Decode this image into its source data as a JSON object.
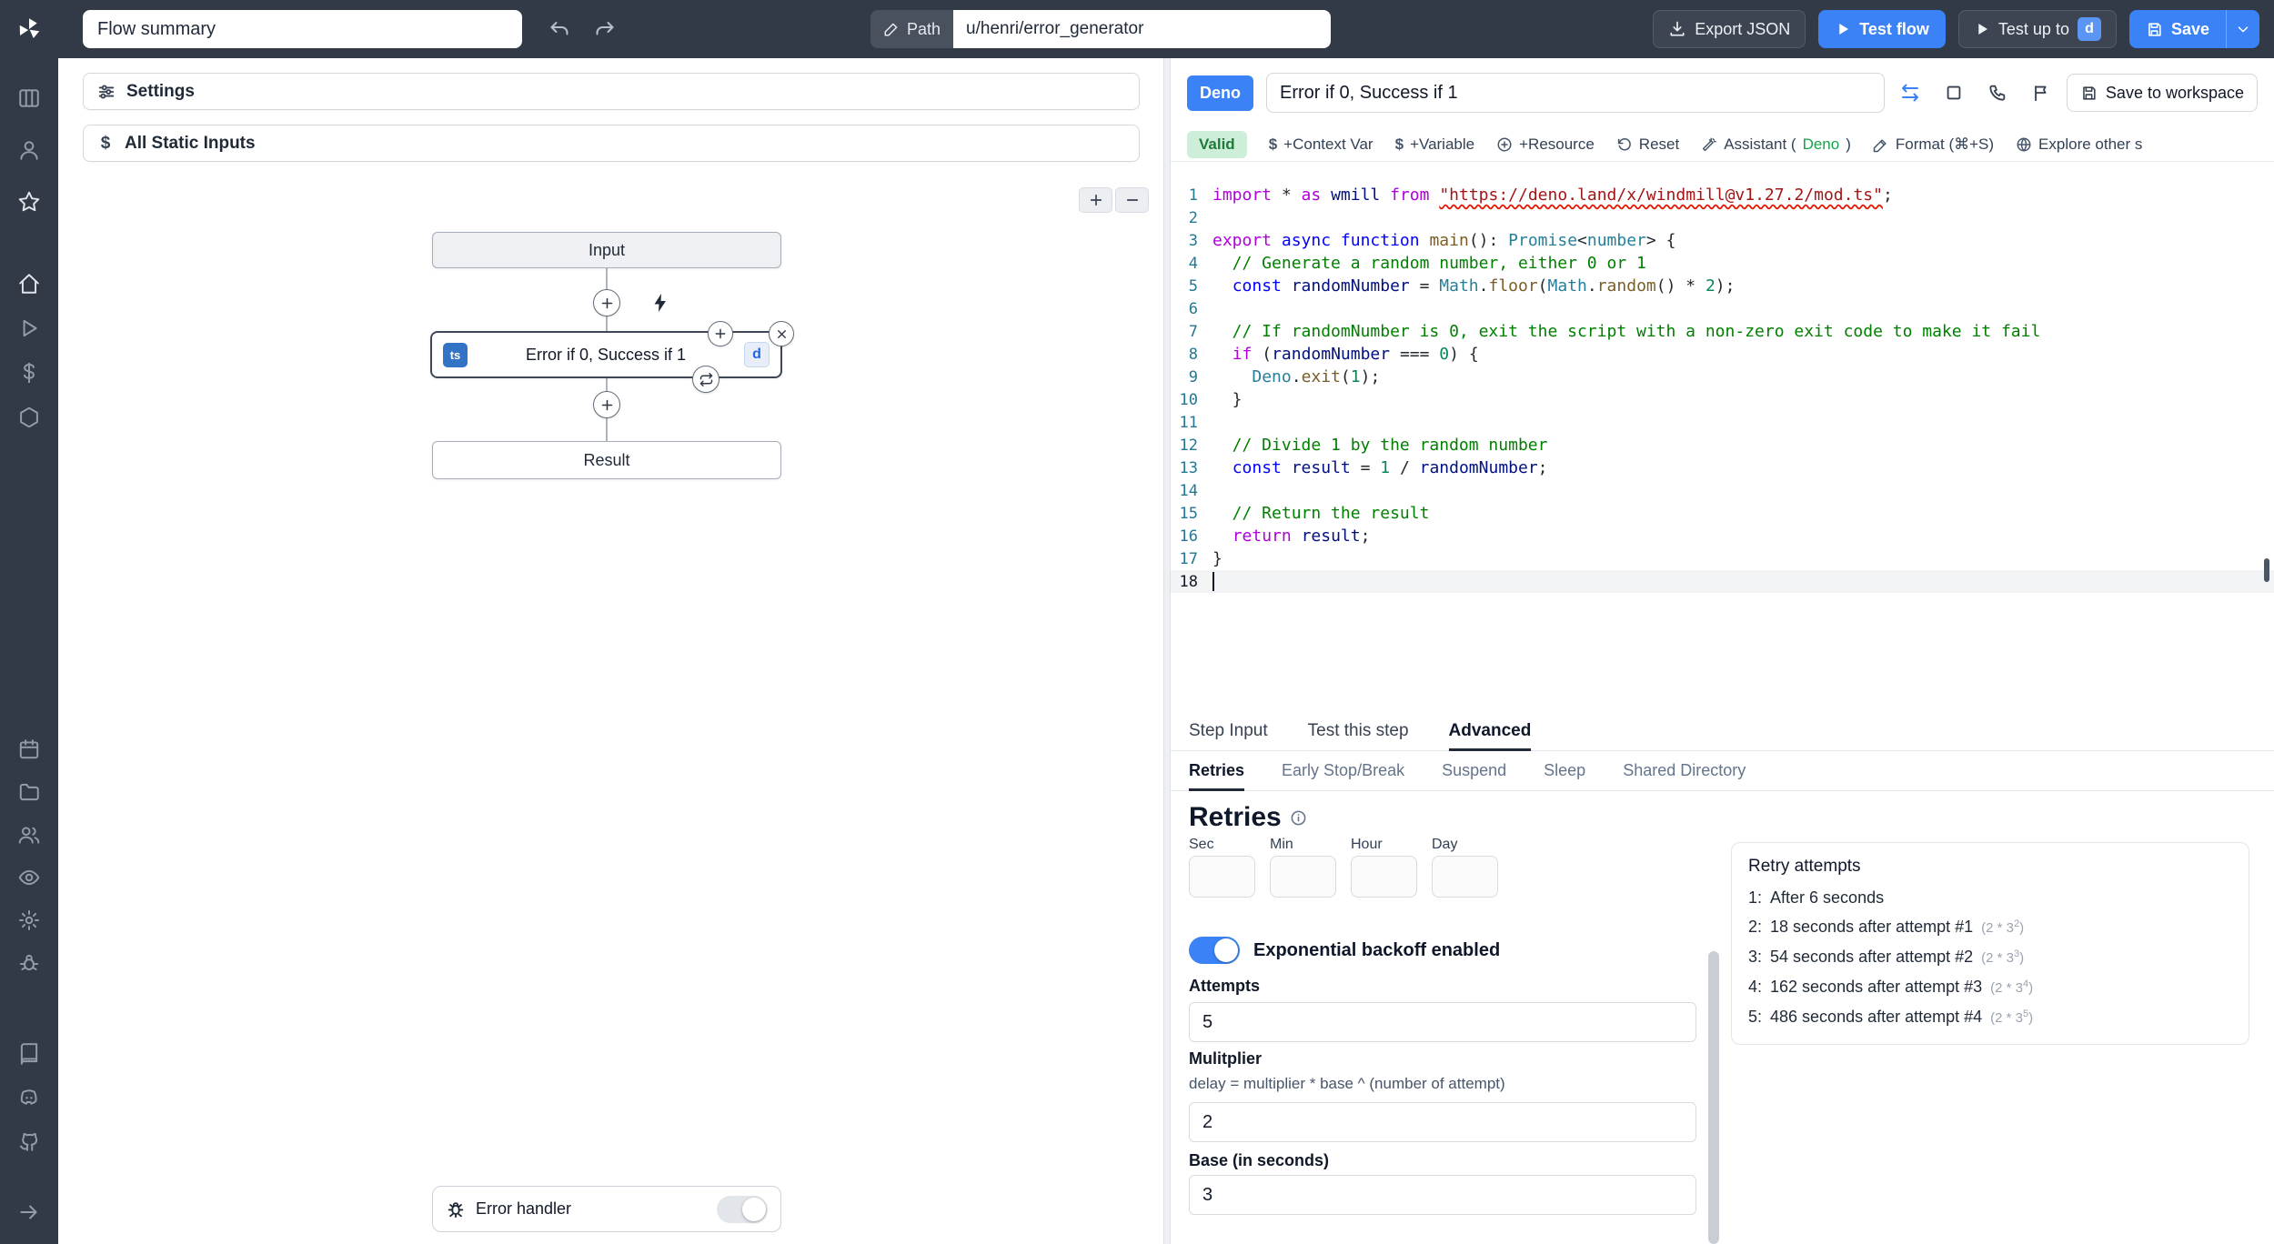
{
  "colors": {
    "accent": "#3b82f6",
    "chrome": "#333a47",
    "valid_bg": "#cdeed9",
    "valid_text": "#217a3c",
    "deno_green": "#16a34a"
  },
  "topbar": {
    "flow_summary": "Flow summary",
    "path_label": "Path",
    "path_value": "u/henri/error_generator",
    "export_json": "Export JSON",
    "test_flow": "Test flow",
    "test_up_to": "Test up to",
    "test_up_to_badge": "d",
    "save": "Save"
  },
  "sidebar": {
    "groups": [
      [
        "columns",
        "user",
        "star"
      ],
      [
        "home",
        "play",
        "dollar",
        "modules"
      ],
      [
        "calendar",
        "folder",
        "users",
        "eye",
        "gear",
        "worker"
      ],
      [
        "book",
        "discord",
        "github"
      ]
    ],
    "expand_icon": "expand"
  },
  "flow": {
    "settings_label": "Settings",
    "static_inputs_label": "All Static Inputs",
    "nodes": {
      "input": "Input",
      "step_lang": "ts",
      "step_title": "Error if 0, Success if 1",
      "step_badge": "d",
      "result": "Result"
    },
    "error_handler_label": "Error handler"
  },
  "editor": {
    "lang_badge": "Deno",
    "step_name": "Error if 0, Success if 1",
    "save_to_workspace": "Save to workspace",
    "valid": "Valid",
    "toolbar": {
      "context_var": "+Context Var",
      "variable": "+Variable",
      "resource": "+Resource",
      "reset": "Reset",
      "assistant_prefix": "Assistant (",
      "assistant_lang": "Deno",
      "assistant_suffix": ")",
      "format": "Format (⌘+S)",
      "explore": "Explore other s"
    }
  },
  "code": {
    "current_line": 18,
    "lines": [
      [
        {
          "t": "import",
          "c": "ct"
        },
        {
          "t": " * ",
          "c": "pn"
        },
        {
          "t": "as",
          "c": "ct"
        },
        {
          "t": " ",
          "c": "pn"
        },
        {
          "t": "wmill",
          "c": "vr"
        },
        {
          "t": " ",
          "c": "pn"
        },
        {
          "t": "from",
          "c": "ct"
        },
        {
          "t": " ",
          "c": "pn"
        },
        {
          "t": "\"https://deno.land/x/windmill@v1.27.2/mod.ts\"",
          "c": "st sq"
        },
        {
          "t": ";",
          "c": "pn"
        }
      ],
      [],
      [
        {
          "t": "export",
          "c": "ct"
        },
        {
          "t": " ",
          "c": "pn"
        },
        {
          "t": "async",
          "c": "kw"
        },
        {
          "t": " ",
          "c": "pn"
        },
        {
          "t": "function",
          "c": "kw"
        },
        {
          "t": " ",
          "c": "pn"
        },
        {
          "t": "main",
          "c": "fn"
        },
        {
          "t": "(): ",
          "c": "pn"
        },
        {
          "t": "Promise",
          "c": "ty"
        },
        {
          "t": "<",
          "c": "pn"
        },
        {
          "t": "number",
          "c": "ty"
        },
        {
          "t": "> {",
          "c": "pn"
        }
      ],
      [
        {
          "t": "  // Generate a random number, either 0 or 1",
          "c": "cm"
        }
      ],
      [
        {
          "t": "  ",
          "c": "pn"
        },
        {
          "t": "const",
          "c": "kw"
        },
        {
          "t": " ",
          "c": "pn"
        },
        {
          "t": "randomNumber",
          "c": "vr"
        },
        {
          "t": " = ",
          "c": "pn"
        },
        {
          "t": "Math",
          "c": "ty"
        },
        {
          "t": ".",
          "c": "pn"
        },
        {
          "t": "floor",
          "c": "fn"
        },
        {
          "t": "(",
          "c": "pn"
        },
        {
          "t": "Math",
          "c": "ty"
        },
        {
          "t": ".",
          "c": "pn"
        },
        {
          "t": "random",
          "c": "fn"
        },
        {
          "t": "() * ",
          "c": "pn"
        },
        {
          "t": "2",
          "c": "nm"
        },
        {
          "t": ");",
          "c": "pn"
        }
      ],
      [],
      [
        {
          "t": "  // If randomNumber is 0, exit the script with a non-zero exit code to make it fail",
          "c": "cm"
        }
      ],
      [
        {
          "t": "  ",
          "c": "pn"
        },
        {
          "t": "if",
          "c": "ct"
        },
        {
          "t": " (",
          "c": "pn"
        },
        {
          "t": "randomNumber",
          "c": "vr"
        },
        {
          "t": " === ",
          "c": "pn"
        },
        {
          "t": "0",
          "c": "nm"
        },
        {
          "t": ") {",
          "c": "pn"
        }
      ],
      [
        {
          "t": "    ",
          "c": "pn"
        },
        {
          "t": "Deno",
          "c": "ty"
        },
        {
          "t": ".",
          "c": "pn"
        },
        {
          "t": "exit",
          "c": "fn"
        },
        {
          "t": "(",
          "c": "pn"
        },
        {
          "t": "1",
          "c": "nm"
        },
        {
          "t": ");",
          "c": "pn"
        }
      ],
      [
        {
          "t": "  }",
          "c": "pn"
        }
      ],
      [],
      [
        {
          "t": "  // Divide 1 by the random number",
          "c": "cm"
        }
      ],
      [
        {
          "t": "  ",
          "c": "pn"
        },
        {
          "t": "const",
          "c": "kw"
        },
        {
          "t": " ",
          "c": "pn"
        },
        {
          "t": "result",
          "c": "vr"
        },
        {
          "t": " = ",
          "c": "pn"
        },
        {
          "t": "1",
          "c": "nm"
        },
        {
          "t": " / ",
          "c": "pn"
        },
        {
          "t": "randomNumber",
          "c": "vr"
        },
        {
          "t": ";",
          "c": "pn"
        }
      ],
      [],
      [
        {
          "t": "  // Return the result",
          "c": "cm"
        }
      ],
      [
        {
          "t": "  ",
          "c": "pn"
        },
        {
          "t": "return",
          "c": "ct"
        },
        {
          "t": " ",
          "c": "pn"
        },
        {
          "t": "result",
          "c": "vr"
        },
        {
          "t": ";",
          "c": "pn"
        }
      ],
      [
        {
          "t": "}",
          "c": "pn"
        }
      ],
      []
    ]
  },
  "tabs": [
    {
      "label": "Step Input"
    },
    {
      "label": "Test this step"
    },
    {
      "label": "Advanced",
      "active": true
    }
  ],
  "subtabs": [
    {
      "label": "Retries",
      "active": true
    },
    {
      "label": "Early Stop/Break"
    },
    {
      "label": "Suspend"
    },
    {
      "label": "Sleep"
    },
    {
      "label": "Shared Directory"
    }
  ],
  "retries": {
    "heading": "Retries",
    "time_fields": [
      {
        "label": "Sec",
        "value": ""
      },
      {
        "label": "Min",
        "value": ""
      },
      {
        "label": "Hour",
        "value": ""
      },
      {
        "label": "Day",
        "value": ""
      }
    ],
    "exponential_label": "Exponential backoff enabled",
    "attempts_label": "Attempts",
    "attempts_value": "5",
    "multiplier_label": "Mulitplier",
    "multiplier_desc": "delay = multiplier * base ^ (number of attempt)",
    "multiplier_value": "2",
    "base_label": "Base (in seconds)",
    "base_value": "3",
    "preview_title": "Retry attempts",
    "preview_items": [
      {
        "n": "1:",
        "text": "After 6 seconds",
        "formula": "",
        "exp": ""
      },
      {
        "n": "2:",
        "text": "18 seconds after attempt #1",
        "formula": "(2 * 3",
        "exp": "2"
      },
      {
        "n": "3:",
        "text": "54 seconds after attempt #2",
        "formula": "(2 * 3",
        "exp": "3"
      },
      {
        "n": "4:",
        "text": "162 seconds after attempt #3",
        "formula": "(2 * 3",
        "exp": "4"
      },
      {
        "n": "5:",
        "text": "486 seconds after attempt #4",
        "formula": "(2 * 3",
        "exp": "5"
      }
    ]
  }
}
